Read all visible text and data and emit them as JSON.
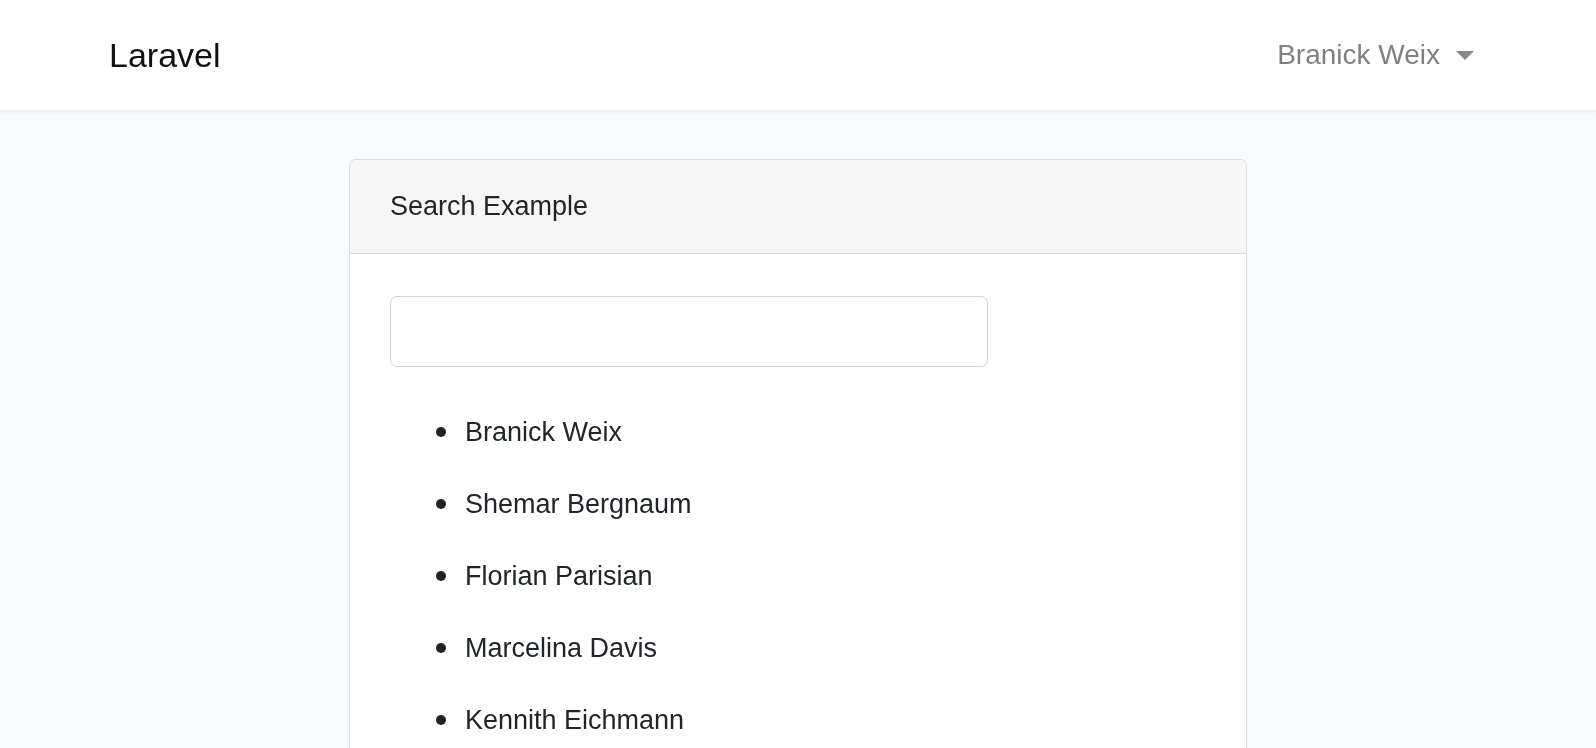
{
  "navbar": {
    "brand": "Laravel",
    "user_menu": {
      "label": "Branick Weix"
    }
  },
  "card": {
    "title": "Search Example",
    "results": [
      "Branick Weix",
      "Shemar Bergnaum",
      "Florian Parisian",
      "Marcelina Davis",
      "Kennith Eichmann"
    ]
  }
}
